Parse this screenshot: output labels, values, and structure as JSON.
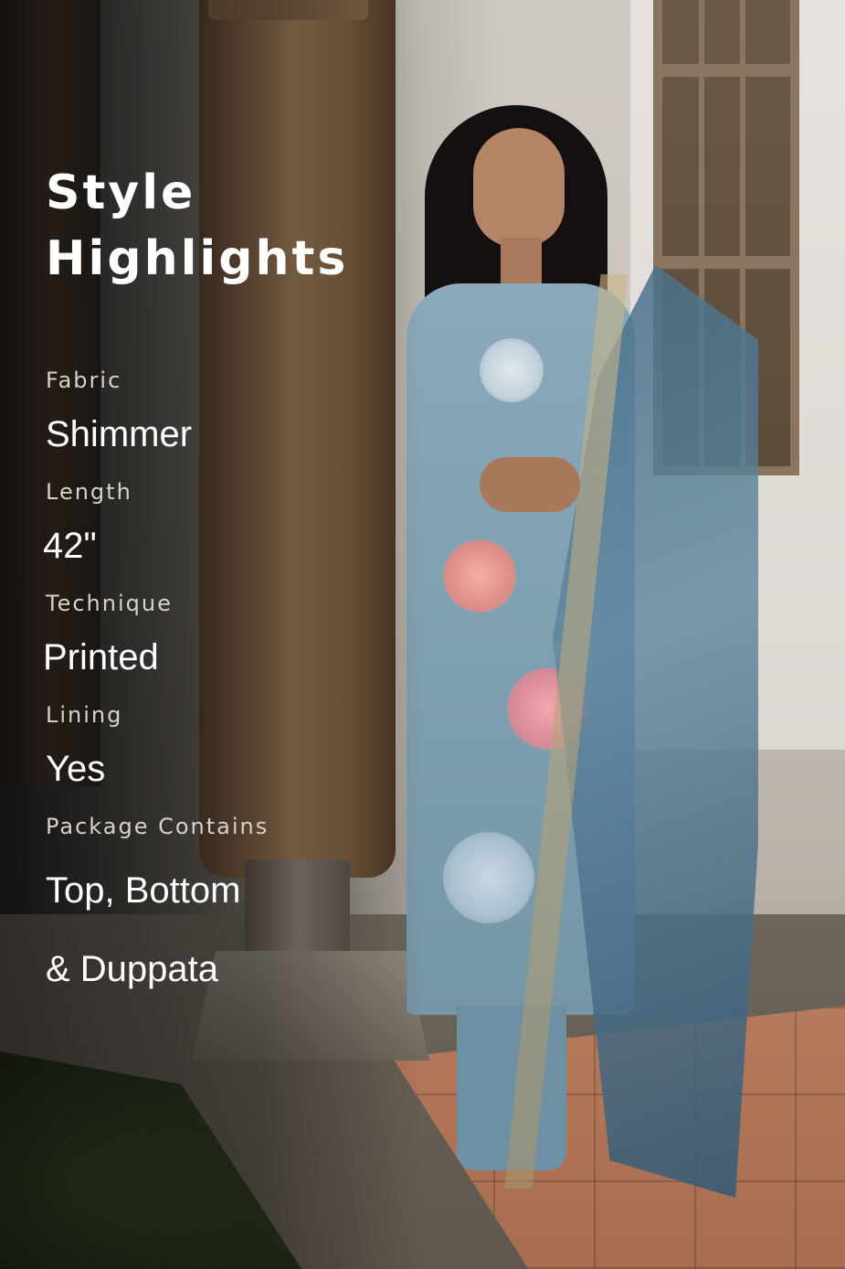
{
  "title": {
    "line1": "Style",
    "line2": "Highlights"
  },
  "specs": [
    {
      "label": "Fabric",
      "value": "Shimmer"
    },
    {
      "label": "Length",
      "value": "42\""
    },
    {
      "label": "Technique",
      "value": "Printed"
    },
    {
      "label": "Lining",
      "value": "Yes"
    },
    {
      "label": "Package Contains",
      "value_line1": "Top, Bottom",
      "value_line2": "& Duppata"
    }
  ],
  "colors": {
    "text_primary": "#ffffff",
    "text_label": "#d6d2cc",
    "kurta": "#8aa9ba",
    "dupatta": "#5f87a0",
    "floral_accent": "#e8a0a0"
  }
}
